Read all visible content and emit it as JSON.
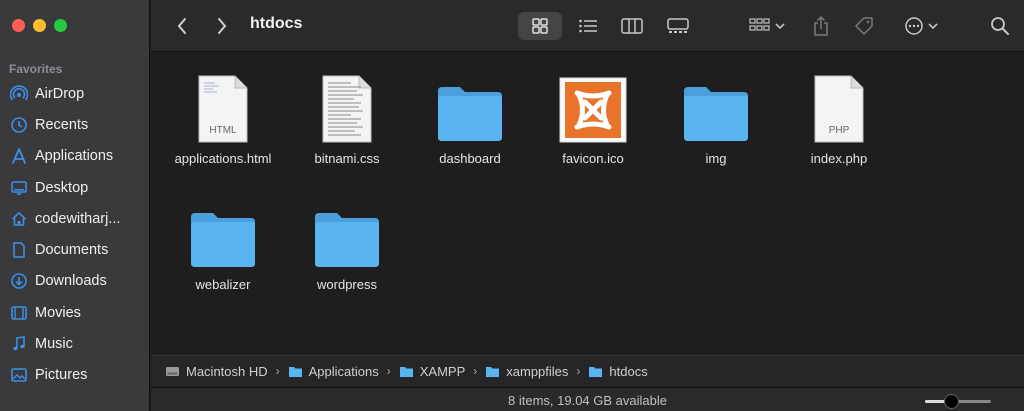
{
  "window": {
    "title": "htdocs"
  },
  "sidebar": {
    "section_title": "Favorites",
    "items": [
      {
        "label": "AirDrop",
        "icon": "airdrop-icon"
      },
      {
        "label": "Recents",
        "icon": "clock-icon"
      },
      {
        "label": "Applications",
        "icon": "applications-icon"
      },
      {
        "label": "Desktop",
        "icon": "desktop-icon"
      },
      {
        "label": "codewitharj...",
        "icon": "home-icon"
      },
      {
        "label": "Documents",
        "icon": "document-icon"
      },
      {
        "label": "Downloads",
        "icon": "download-icon"
      },
      {
        "label": "Movies",
        "icon": "film-icon"
      },
      {
        "label": "Music",
        "icon": "music-icon"
      },
      {
        "label": "Pictures",
        "icon": "picture-icon"
      }
    ]
  },
  "files": [
    {
      "name": "applications.html",
      "type": "html-file",
      "badge": "HTML"
    },
    {
      "name": "bitnami.css",
      "type": "css-file",
      "badge": ""
    },
    {
      "name": "dashboard",
      "type": "folder",
      "badge": ""
    },
    {
      "name": "favicon.ico",
      "type": "ico-file",
      "badge": ""
    },
    {
      "name": "img",
      "type": "folder",
      "badge": ""
    },
    {
      "name": "index.php",
      "type": "php-file",
      "badge": "PHP"
    },
    {
      "name": "webalizer",
      "type": "folder",
      "badge": ""
    },
    {
      "name": "wordpress",
      "type": "folder",
      "badge": ""
    }
  ],
  "pathbar": {
    "crumbs": [
      {
        "label": "Macintosh HD",
        "icon": "disk-icon"
      },
      {
        "label": "Applications",
        "icon": "folder-icon"
      },
      {
        "label": "XAMPP",
        "icon": "folder-icon"
      },
      {
        "label": "xamppfiles",
        "icon": "folder-icon"
      },
      {
        "label": "htdocs",
        "icon": "folder-icon"
      }
    ],
    "separator": "›"
  },
  "status": {
    "text": "8 items, 19.04 GB available",
    "zoom_level": 0.4
  },
  "colors": {
    "accent": "#3b8fe8",
    "folder": "#5ab4f0",
    "xampp": "#e8742b"
  }
}
